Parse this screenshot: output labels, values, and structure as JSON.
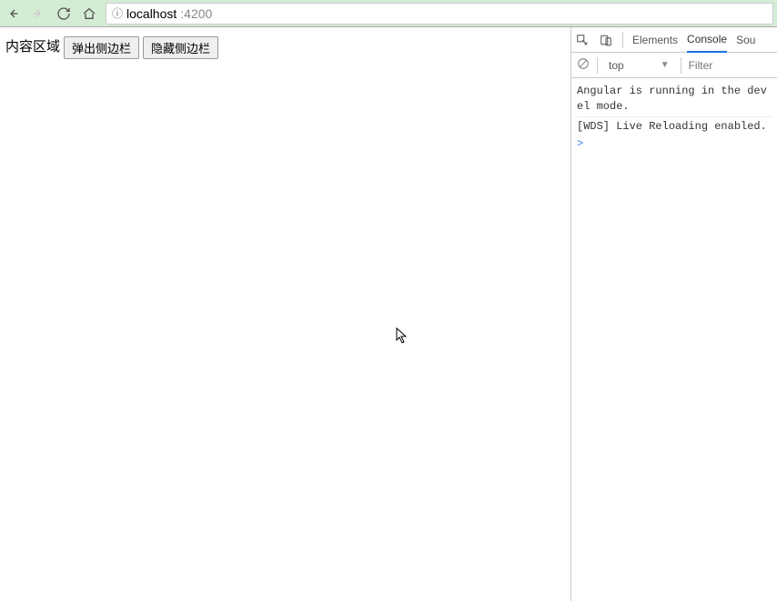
{
  "browser": {
    "url_host": "localhost",
    "url_port": ":4200"
  },
  "page": {
    "content_label": "内容区域",
    "open_sidebar_btn": "弹出侧边栏",
    "hide_sidebar_btn": "隐藏侧边栏"
  },
  "devtools": {
    "tabs": {
      "elements": "Elements",
      "console": "Console",
      "sources": "Sou"
    },
    "filterbar": {
      "context": "top",
      "filter_placeholder": "Filter"
    },
    "console": {
      "line1": "Angular is running in the devel mode.",
      "line2": "[WDS] Live Reloading enabled.",
      "prompt": ">"
    }
  }
}
